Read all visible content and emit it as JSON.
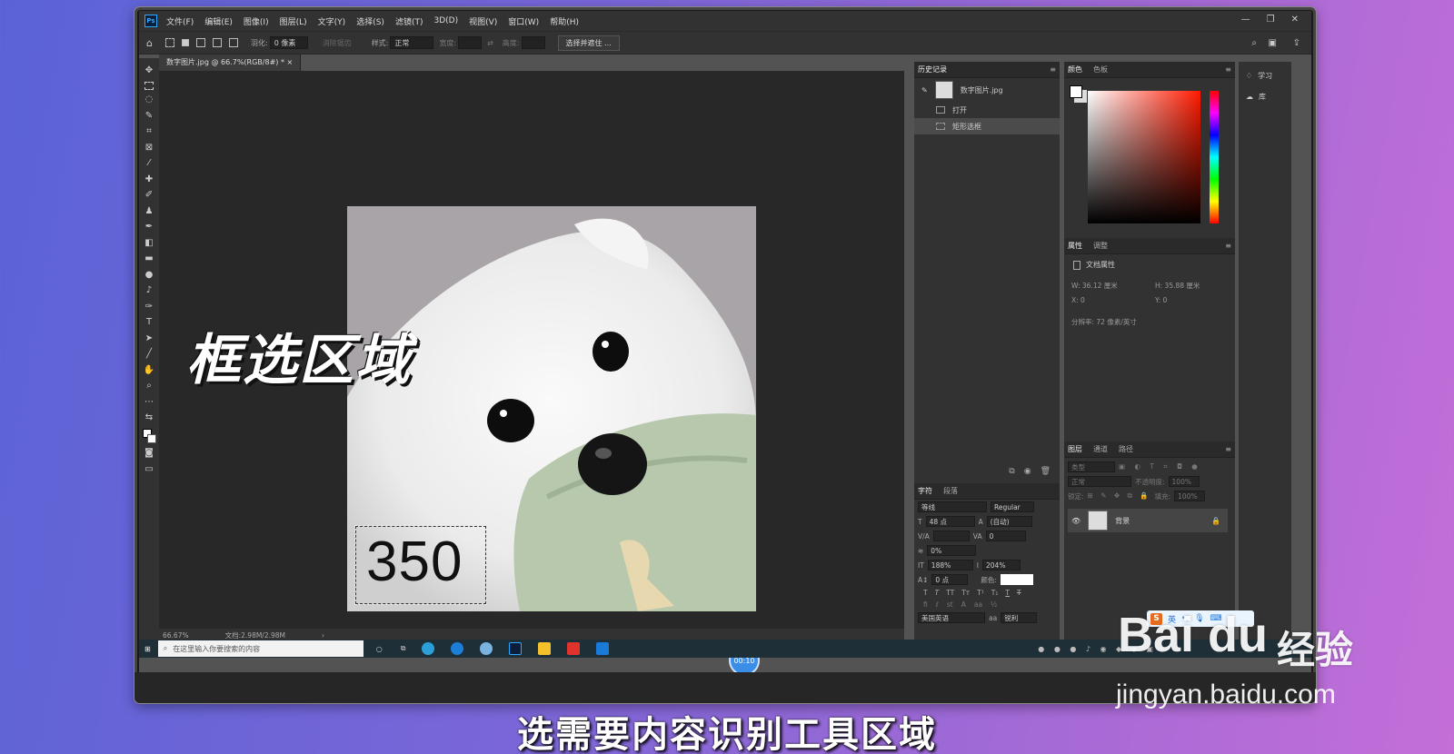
{
  "menubar": {
    "items": [
      "文件(F)",
      "编辑(E)",
      "图像(I)",
      "图层(L)",
      "文字(Y)",
      "选择(S)",
      "滤镜(T)",
      "3D(D)",
      "视图(V)",
      "窗口(W)",
      "帮助(H)"
    ],
    "app_logo": "Ps"
  },
  "options": {
    "feather_label": "羽化:",
    "feather_value": "0 像素",
    "antialias": "消除锯齿",
    "style_label": "样式:",
    "style_value": "正常",
    "width_label": "宽度:",
    "height_label": "高度:",
    "select_mask_button": "选择并遮住 ..."
  },
  "document": {
    "tab_title": "数字图片.jpg @ 66.7%(RGB/8#) *",
    "zoom": "66.67%",
    "doc_size": "文档:2.98M/2.98M",
    "canvas_number": "350",
    "timer": "00:10"
  },
  "history": {
    "tab": "历史记录",
    "snapshot": "数字图片.jpg",
    "items": [
      "打开",
      "矩形选框"
    ]
  },
  "color_panel": {
    "tabs": [
      "颜色",
      "色板"
    ]
  },
  "properties": {
    "tabs": [
      "属性",
      "调整"
    ],
    "doc_props": "文档属性",
    "w": "W: 36.12 厘米",
    "h": "H: 35.88 厘米",
    "x": "X: 0",
    "y": "Y: 0",
    "resolution": "分辨率: 72 像素/英寸"
  },
  "character": {
    "tabs": [
      "字符",
      "段落"
    ],
    "font_family": "等线",
    "font_style": "Regular",
    "size": "48 点",
    "leading": "(自动)",
    "kerning": "0",
    "tracking_pct": "0%",
    "vscale": "188%",
    "hscale": "204%",
    "baseline": "0 点",
    "color_label": "颜色:",
    "language": "美国英语",
    "aa": "锐利"
  },
  "layers": {
    "tabs": [
      "图层",
      "通道",
      "路径"
    ],
    "kind_label": "类型",
    "blend_mode": "正常",
    "opacity_label": "不透明度:",
    "opacity": "100%",
    "lock_label": "锁定:",
    "fill_label": "填充:",
    "fill": "100%",
    "layer_name": "背景"
  },
  "learn_panel": {
    "learn": "学习",
    "libraries": "库"
  },
  "taskbar": {
    "search_placeholder": "在这里输入你要搜索的内容"
  },
  "overlay": {
    "title": "框选区域",
    "subtitle": "选需要内容识别工具区域",
    "ime": "英",
    "watermark_logo": "Bai du",
    "watermark_cn": "经验",
    "watermark_url": "jingyan.baidu.com"
  }
}
